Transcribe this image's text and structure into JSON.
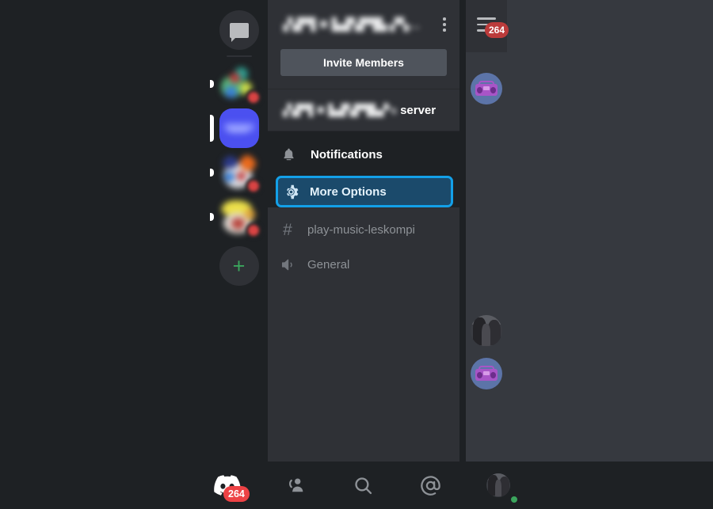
{
  "app": {
    "name": "Discord",
    "theme": "dark"
  },
  "colors": {
    "app_background": "#1e2124",
    "channel_panel_background": "#2f3136",
    "chat_peek_background": "#36393f",
    "highlight_border": "#13a0e8",
    "highlight_fill": "#1b4a6b",
    "badge_red": "#ed4245",
    "online_green": "#3ba55d",
    "add_server_green": "#3ba55d",
    "invite_button": "#4f545c",
    "muted_text": "#8e9297"
  },
  "guild_rail": {
    "items": [
      {
        "name": "direct-messages",
        "icon": "chat-bubble-icon",
        "type": "dm",
        "selected": false,
        "unread": false,
        "badge": null
      },
      {
        "name": "server-1",
        "icon": "server-avatar",
        "type": "server",
        "selected": false,
        "unread": true,
        "badge": "",
        "blurred": true
      },
      {
        "name": "server-2",
        "icon": "server-avatar",
        "type": "server",
        "selected": true,
        "unread": true,
        "badge": null,
        "blurred": true
      },
      {
        "name": "server-3",
        "icon": "server-avatar",
        "type": "server",
        "selected": false,
        "unread": true,
        "badge": "",
        "blurred": true
      },
      {
        "name": "server-4",
        "icon": "server-avatar",
        "type": "server",
        "selected": false,
        "unread": true,
        "badge": "",
        "blurred": true
      },
      {
        "name": "add-server",
        "icon": "plus-icon",
        "type": "add",
        "selected": false,
        "unread": false,
        "badge": null
      }
    ]
  },
  "channel_panel": {
    "header": {
      "server_name": "▗▚▛▜ ✖ ▙▟▚▛▜▙ ▞▚…",
      "server_name_blurred": true,
      "overflow_menu": "more-vertical-icon"
    },
    "invite_button_label": "Invite Members",
    "server_context_row": {
      "blurred_name": "▗▚▛▜ ✖ ▙▟▚▛▜▙▞'s",
      "suffix": "server"
    },
    "menu_items": [
      {
        "label": "Notifications",
        "icon": "bell-icon",
        "highlighted": false
      },
      {
        "label": "More Options",
        "icon": "gear-icon",
        "highlighted": true
      }
    ],
    "channels": [
      {
        "name": "play-music-leskompi",
        "icon": "hash-icon",
        "type": "text"
      },
      {
        "name": "General",
        "icon": "speaker-icon",
        "type": "voice"
      }
    ]
  },
  "chat_peek": {
    "menu_icon": "hamburger-menu-icon",
    "menu_badge": "264",
    "members": [
      {
        "name": "member-avatar-boombox",
        "icon": "boombox-avatar",
        "position": "top"
      },
      {
        "name": "member-avatar-photo",
        "icon": "photo-avatar",
        "position": "middle"
      },
      {
        "name": "member-avatar-boombox-2",
        "icon": "boombox-avatar",
        "position": "bottom"
      }
    ]
  },
  "bottom_nav": {
    "items": [
      {
        "name": "servers-tab",
        "icon": "discord-logo-icon",
        "badge": "264",
        "active": true
      },
      {
        "name": "friends-tab",
        "icon": "person-wave-icon",
        "badge": null,
        "active": false
      },
      {
        "name": "search-tab",
        "icon": "search-icon",
        "badge": null,
        "active": false
      },
      {
        "name": "mentions-tab",
        "icon": "at-mention-icon",
        "badge": null,
        "active": false
      },
      {
        "name": "profile-tab",
        "icon": "user-avatar-icon",
        "badge": null,
        "active": false,
        "status": "online"
      }
    ]
  }
}
